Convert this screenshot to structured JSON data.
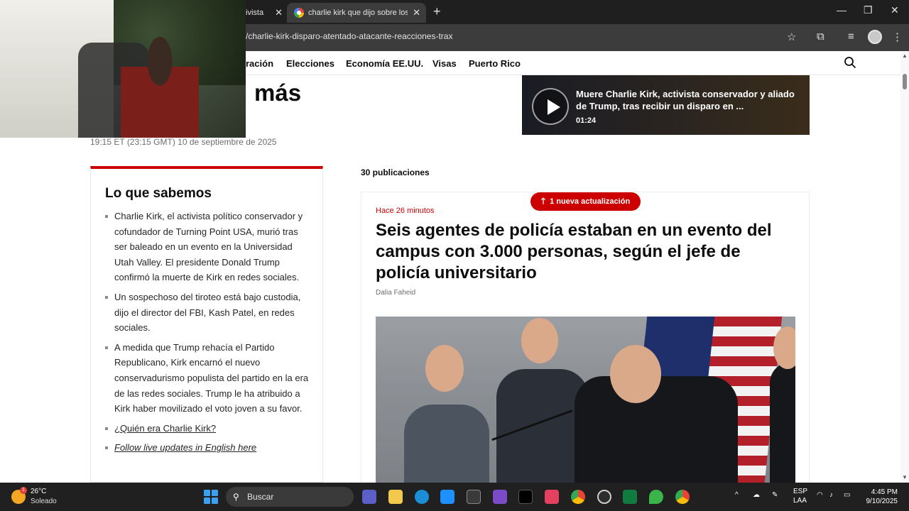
{
  "browser": {
    "tabs": [
      {
        "title": "ivista",
        "active": false
      },
      {
        "title": "charlie kirk que dijo sobre los n",
        "active": true
      }
    ],
    "new_tab": "+",
    "url": "/charlie-kirk-disparo-atentado-atacante-reacciones-trax",
    "window_controls": {
      "minimize": "—",
      "maximize": "❐",
      "close": "✕"
    }
  },
  "site_nav": {
    "items": [
      "ración",
      "Elecciones",
      "Economía EE.UU.",
      "Visas",
      "Puerto Rico"
    ]
  },
  "headline_fragment": "más",
  "timestamp": "19:15 ET (23:15 GMT) 10 de septiembre de 2025",
  "video": {
    "title": "Muere Charlie Kirk, activista conservador y aliado de Trump, tras recibir un disparo en ...",
    "duration": "01:24"
  },
  "sidebar": {
    "title": "Lo que sabemos",
    "bullets": [
      "Charlie Kirk, el activista político conservador y cofundador de Turning Point USA, murió tras ser baleado en un evento en la Universidad Utah Valley. El presidente Donald Trump confirmó la muerte de Kirk en redes sociales.",
      "Un sospechoso del tiroteo está bajo custodia, dijo el director del FBI, Kash Patel, en redes sociales.",
      "A medida que Trump rehacía el Partido Republicano, Kirk encarnó el nuevo conservadurismo populista del partido en la era de las redes sociales. Trump le ha atribuido a Kirk haber movilizado el voto joven a su favor."
    ],
    "link": "¿Quién era Charlie Kirk?",
    "english_link": "Follow live updates in English here"
  },
  "feed": {
    "posts_count": "30 publicaciones",
    "update_pill": "1 nueva actualización",
    "post": {
      "ago": "Hace 26 minutos",
      "headline": "Seis agentes de policía estaban en un evento del campus con 3.000 personas, según el jefe de policía universitario",
      "author": "Dalia Faheid"
    }
  },
  "taskbar": {
    "weather_temp": "26°C",
    "weather_cond": "Soleado",
    "weather_badge": "1",
    "search_placeholder": "Buscar",
    "lang_top": "ESP",
    "lang_bottom": "LAA",
    "time": "4:45 PM",
    "date": "9/10/2025"
  },
  "colors": {
    "accent_red": "#cc0000",
    "chrome_dark": "#1f1f1f",
    "chrome_bar": "#3c3c3c"
  }
}
